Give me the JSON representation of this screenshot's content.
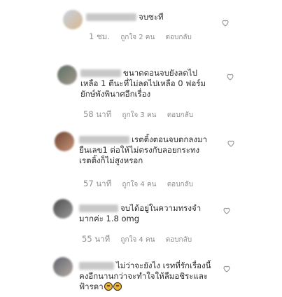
{
  "comments": [
    {
      "lines": [
        "จบซะที"
      ],
      "time": "1 ชม.",
      "likes": "ถูกใจ 2 คน",
      "reply": "ตอบกลับ",
      "avatar_colors": [
        "#b9c6d4",
        "#d9b08a"
      ]
    },
    {
      "lines": [
        "ขนาดตอนจบยังลดไป",
        "เหลือ 1 ตีนะที่ไม่ลดไปเหลือ 0 ฟอร์ม",
        "ยักษ์พังพินาศอีกเรื่อง"
      ],
      "time": "58 นาที",
      "likes": "ถูกใจ 3 คน",
      "reply": "ตอบกลับ",
      "avatar_colors": [
        "#6d7d6f",
        "#9a8f84"
      ]
    },
    {
      "lines": [
        "เรตติ้งตอนจบตกลงมา",
        "ยืนเลข1 ต่อให้ไม่ตรงกับลอยกระทง",
        "เรตติ้งก็ไม่สูงหรอก"
      ],
      "time": "57 นาที",
      "likes": "ถูกใจ 4 คน",
      "reply": "ตอบกลับ",
      "avatar_colors": [
        "#7a4e3c",
        "#c49276"
      ]
    },
    {
      "lines": [
        "จบได้อยู่ในความทรงจำ",
        "มากค่ะ 1.8 omg"
      ],
      "time": "55 นาที",
      "likes": "ถูกใจ 4 คน",
      "reply": "ตอบกลับ",
      "avatar_colors": [
        "#5e5e5e",
        "#8c8c8c"
      ]
    },
    {
      "lines": [
        "ไม่ว่าจะยังไง เรทที่รักเรื่องนี้",
        "คงอีกนานกว่าจะทำใจให้ลืมอชิระและ",
        "ฟ้ารดา"
      ],
      "time": "",
      "likes": "",
      "reply": "",
      "avatar_colors": [
        "#6c6f7c",
        "#b0a7a0"
      ],
      "trailing_emojis": [
        "sad-face-emoji",
        "sad-face-emoji"
      ]
    }
  ],
  "icons": {
    "like": "heart-outline-icon"
  }
}
